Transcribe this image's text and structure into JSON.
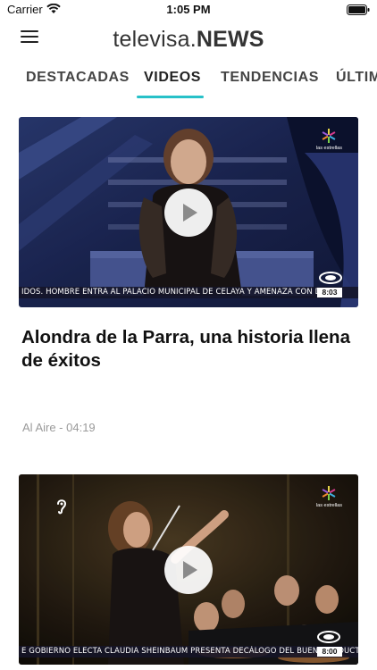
{
  "status_bar": {
    "carrier": "Carrier",
    "time": "1:05 PM"
  },
  "header": {
    "logo_light": "televisa.",
    "logo_bold": "NEWS"
  },
  "tabs": [
    {
      "label": "DESTACADAS",
      "active": false
    },
    {
      "label": "VIDEOS",
      "active": true
    },
    {
      "label": "TENDENCIAS",
      "active": false
    },
    {
      "label": "ÚLTIM",
      "active": false
    }
  ],
  "colors": {
    "accent": "#27c1c8"
  },
  "cards": [
    {
      "ticker": "IDOS.      HOMBRE ENTRA AL PALACIO MUNICIPAL DE CELAYA Y AMENAZA CON DET",
      "clip_time": "8:03",
      "channel_label": "las estrellas",
      "title": "Alondra de la Parra, una historia llena de éxitos",
      "meta": "Al Aire - 04:19"
    },
    {
      "ticker": "E GOBIERNO ELECTA CLAUDIA SHEINBAUM PRESENTA DECÁLOGO DEL BUEN CONDUCTOR",
      "clip_time": "8:00",
      "channel_label": "las estrellas"
    }
  ]
}
